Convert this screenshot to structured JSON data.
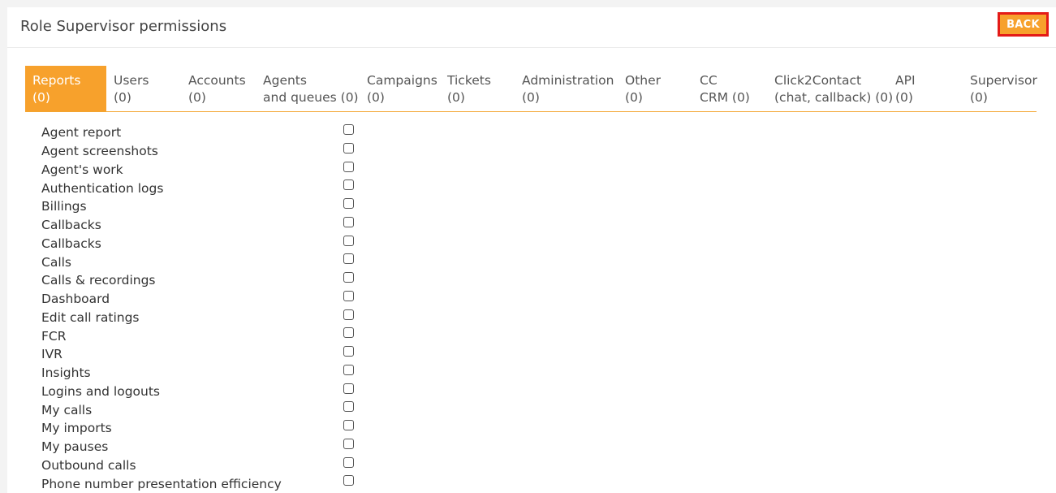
{
  "header": {
    "title": "Role Supervisor permissions",
    "back_label": "BACK"
  },
  "colors": {
    "accent": "#f7a12c",
    "back_border": "#e41b17",
    "tab_underline": "#f3a531"
  },
  "tabs": [
    {
      "line1": "Reports",
      "line2": "(0)",
      "active": true
    },
    {
      "line1": "Users",
      "line2": "(0)",
      "active": false
    },
    {
      "line1": "Accounts",
      "line2": "(0)",
      "active": false
    },
    {
      "line1": "Agents",
      "line2": "and queues (0)",
      "active": false
    },
    {
      "line1": "Campaigns",
      "line2": "(0)",
      "active": false
    },
    {
      "line1": "Tickets",
      "line2": "(0)",
      "active": false
    },
    {
      "line1": "Administration",
      "line2": "(0)",
      "active": false
    },
    {
      "line1": "Other",
      "line2": "(0)",
      "active": false
    },
    {
      "line1": "CC",
      "line2": "CRM (0)",
      "active": false
    },
    {
      "line1": "Click2Contact",
      "line2": "(chat, callback) (0)",
      "active": false
    },
    {
      "line1": "API",
      "line2": "(0)",
      "active": false
    },
    {
      "line1": "Supervisor",
      "line2": "(0)",
      "active": false
    }
  ],
  "permissions": [
    {
      "label": "Agent report",
      "checked": false
    },
    {
      "label": "Agent screenshots",
      "checked": false
    },
    {
      "label": "Agent's work",
      "checked": false
    },
    {
      "label": "Authentication logs",
      "checked": false
    },
    {
      "label": "Billings",
      "checked": false
    },
    {
      "label": "Callbacks",
      "checked": false
    },
    {
      "label": "Callbacks",
      "checked": false
    },
    {
      "label": "Calls",
      "checked": false
    },
    {
      "label": "Calls & recordings",
      "checked": false
    },
    {
      "label": "Dashboard",
      "checked": false
    },
    {
      "label": "Edit call ratings",
      "checked": false
    },
    {
      "label": "FCR",
      "checked": false
    },
    {
      "label": "IVR",
      "checked": false
    },
    {
      "label": "Insights",
      "checked": false
    },
    {
      "label": "Logins and logouts",
      "checked": false
    },
    {
      "label": "My calls",
      "checked": false
    },
    {
      "label": "My imports",
      "checked": false
    },
    {
      "label": "My pauses",
      "checked": false
    },
    {
      "label": "Outbound calls",
      "checked": false
    },
    {
      "label": "Phone number presentation efficiency",
      "checked": false
    }
  ]
}
